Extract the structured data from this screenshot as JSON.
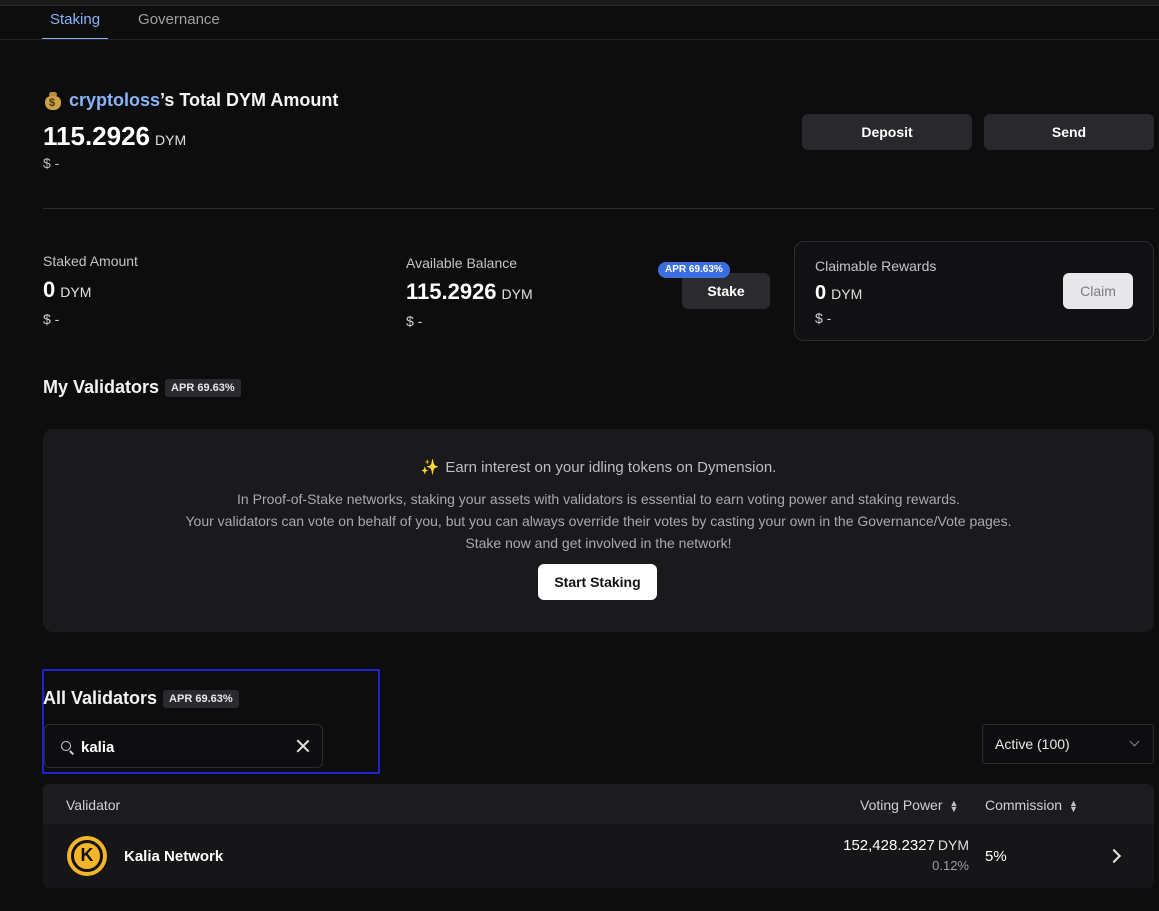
{
  "tabs": [
    {
      "label": "Staking"
    },
    {
      "label": "Governance"
    }
  ],
  "summary": {
    "username": "cryptoloss",
    "title_suffix": "’s Total DYM Amount",
    "total_amount": "115.2926",
    "unit": "DYM",
    "usd": "$ -",
    "deposit_label": "Deposit",
    "send_label": "Send"
  },
  "stats": {
    "staked": {
      "label": "Staked Amount",
      "value": "0",
      "unit": "DYM",
      "usd": "$ -"
    },
    "available": {
      "label": "Available Balance",
      "value": "115.2926",
      "unit": "DYM",
      "usd": "$ -"
    },
    "apr_pill": "APR 69.63%",
    "stake_label": "Stake",
    "rewards": {
      "label": "Claimable Rewards",
      "value": "0",
      "unit": "DYM",
      "usd": "$ -",
      "claim_label": "Claim"
    }
  },
  "my_validators": {
    "heading": "My Validators",
    "apr": "APR 69.63%",
    "empty": {
      "title": "Earn interest on your idling tokens on Dymension.",
      "line1": "In Proof-of-Stake networks, staking your assets with validators is essential to earn voting power and staking rewards.",
      "line2": "Your validators can vote on behalf of you, but you can always override their votes by casting your own in the Governance/Vote pages.",
      "line3": "Stake now and get involved in the network!",
      "button": "Start Staking"
    }
  },
  "all_validators": {
    "heading": "All Validators",
    "apr": "APR 69.63%",
    "search_value": "kalia",
    "filter_value": "Active (100)",
    "columns": {
      "validator": "Validator",
      "voting_power": "Voting Power",
      "commission": "Commission"
    },
    "rows": [
      {
        "logo_letter": "K",
        "name": "Kalia Network",
        "voting_power": "152,428.2327",
        "vp_unit": "DYM",
        "vp_pct": "0.12%",
        "commission": "5%"
      }
    ]
  },
  "colors": {
    "accent": "#8ab4f8",
    "apr_blue": "#3b6fe0",
    "highlight": "#1d22c9",
    "validator_logo": "#f3b52a"
  }
}
